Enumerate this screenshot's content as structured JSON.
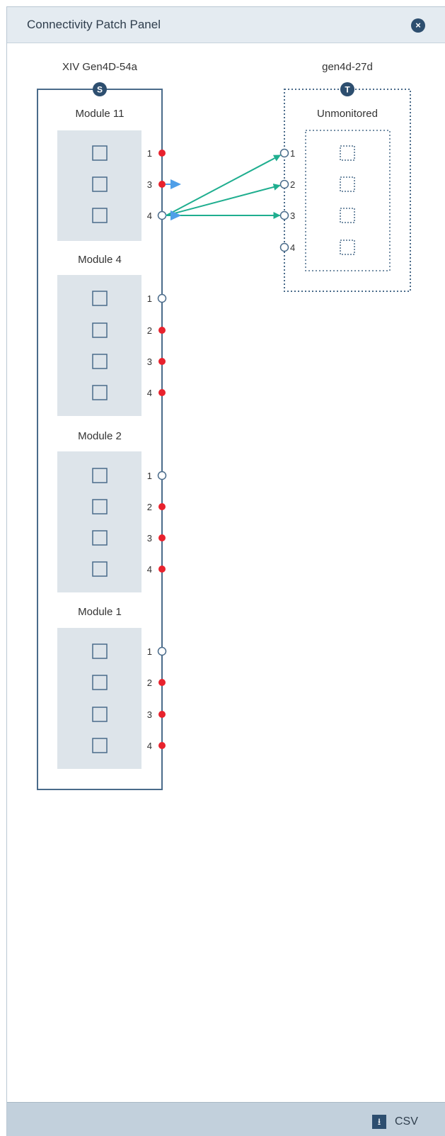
{
  "panel": {
    "title": "Connectivity Patch Panel"
  },
  "header": {
    "close_icon": "close-icon",
    "close_glyph": "×"
  },
  "footer": {
    "csv_label": "CSV",
    "csv_icon": "download-icon",
    "csv_glyph": "⭳"
  },
  "colors": {
    "port_connected": "#e8222d",
    "port_empty": "#ffffff",
    "outline": "#4a6b8a",
    "module_fill": "#dde4ea",
    "badge": "#2d4e6f",
    "link": "#1fae8f",
    "pending_arrow": "#4f9fe8"
  },
  "source": {
    "name": "XIV Gen4D-54a",
    "badge": "S",
    "modules": [
      {
        "label": "Module 11",
        "ports": [
          {
            "num": "1",
            "state": "connected"
          },
          {
            "num": "3",
            "state": "connected",
            "arrow": true
          },
          {
            "num": "4",
            "state": "empty",
            "arrow": true
          }
        ]
      },
      {
        "label": "Module 4",
        "ports": [
          {
            "num": "1",
            "state": "empty"
          },
          {
            "num": "2",
            "state": "connected"
          },
          {
            "num": "3",
            "state": "connected"
          },
          {
            "num": "4",
            "state": "connected"
          }
        ]
      },
      {
        "label": "Module 2",
        "ports": [
          {
            "num": "1",
            "state": "empty"
          },
          {
            "num": "2",
            "state": "connected"
          },
          {
            "num": "3",
            "state": "connected"
          },
          {
            "num": "4",
            "state": "connected"
          }
        ]
      },
      {
        "label": "Module 1",
        "ports": [
          {
            "num": "1",
            "state": "empty"
          },
          {
            "num": "2",
            "state": "connected"
          },
          {
            "num": "3",
            "state": "connected"
          },
          {
            "num": "4",
            "state": "connected"
          }
        ]
      }
    ]
  },
  "target": {
    "name": "gen4d-27d",
    "badge": "T",
    "subtitle": "Unmonitored",
    "ports": [
      {
        "num": "1",
        "state": "empty"
      },
      {
        "num": "2",
        "state": "empty"
      },
      {
        "num": "3",
        "state": "empty"
      },
      {
        "num": "4",
        "state": "empty"
      }
    ]
  },
  "connections": [
    {
      "from_module": "Module 11",
      "from_port": "4",
      "to_port": "1"
    },
    {
      "from_module": "Module 11",
      "from_port": "4",
      "to_port": "2"
    },
    {
      "from_module": "Module 11",
      "from_port": "4",
      "to_port": "3"
    }
  ]
}
